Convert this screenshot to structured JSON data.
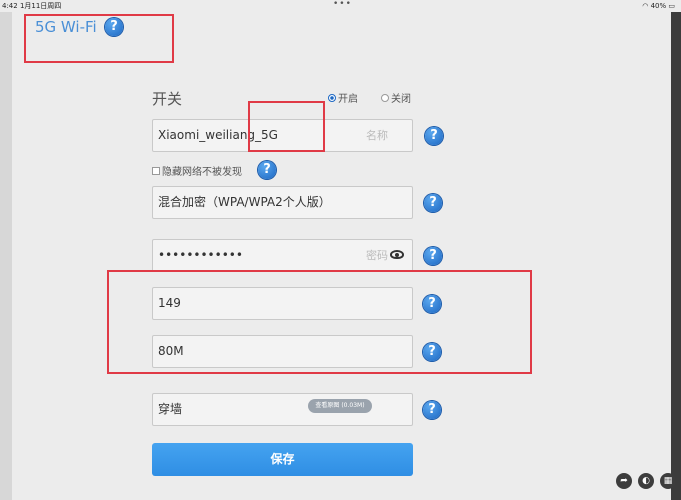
{
  "statusbar": {
    "time_date": "4:42  1月11日周四",
    "dots": "•••",
    "battery": "40%"
  },
  "page": {
    "title": "5G Wi-Fi"
  },
  "switch": {
    "label": "开关",
    "on_label": "开启",
    "off_label": "关闭",
    "selected": "开启"
  },
  "ssid": {
    "value": "Xiaomi_weiliang_5G",
    "placeholder": "名称"
  },
  "hide_network": {
    "label": "隐藏网络不被发现",
    "checked": false
  },
  "encryption": {
    "value": "混合加密（WPA/WPA2个人版）"
  },
  "password": {
    "value": "••••••••••••",
    "placeholder": "密码"
  },
  "channel": {
    "value": "149"
  },
  "bandwidth": {
    "value": "80M"
  },
  "signal": {
    "value": "穿墙"
  },
  "image_badge": {
    "text": "查看原图 (0.03M)"
  },
  "save": {
    "label": "保存"
  },
  "colors": {
    "accent": "#2f8ee4",
    "highlight": "#e03a46",
    "title": "#4a8fd6"
  },
  "bottom_controls": {
    "icons": [
      "share-icon",
      "reply-icon",
      "grid-icon"
    ]
  }
}
